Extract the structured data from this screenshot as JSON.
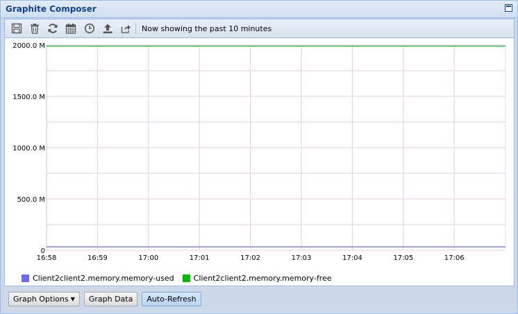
{
  "window": {
    "title": "Graphite Composer"
  },
  "toolbar": {
    "buttons": [
      {
        "icon": "save-icon"
      },
      {
        "icon": "trash-icon"
      },
      {
        "icon": "refresh-icon"
      },
      {
        "icon": "calendar-icon"
      },
      {
        "icon": "clock-icon"
      },
      {
        "icon": "upload-icon"
      },
      {
        "icon": "share-icon"
      }
    ],
    "status": "Now showing the past 10 minutes"
  },
  "chart_data": {
    "type": "line",
    "x": [
      "16:58",
      "16:59",
      "17:00",
      "17:01",
      "17:02",
      "17:03",
      "17:04",
      "17:05",
      "17:06"
    ],
    "yticks": [
      "0",
      "500.0 M",
      "1000.0 M",
      "1500.0 M",
      "2000.0 M"
    ],
    "ylim": [
      0,
      2000
    ],
    "grid": true,
    "legend_position": "bottom-left",
    "series": [
      {
        "name": "Client2client2.memory.memory-used",
        "color": "#6b6bf0",
        "values": [
          33,
          33,
          33,
          33,
          33,
          33,
          33,
          33,
          33,
          33
        ]
      },
      {
        "name": "Client2client2.memory.memory-free",
        "color": "#00bb00",
        "values": [
          1990,
          1990,
          1990,
          1990,
          1990,
          1990,
          1990,
          1990,
          1990,
          1990
        ]
      }
    ]
  },
  "buttons": {
    "graph_options": "Graph Options",
    "graph_data": "Graph Data",
    "auto_refresh": "Auto-Refresh"
  }
}
